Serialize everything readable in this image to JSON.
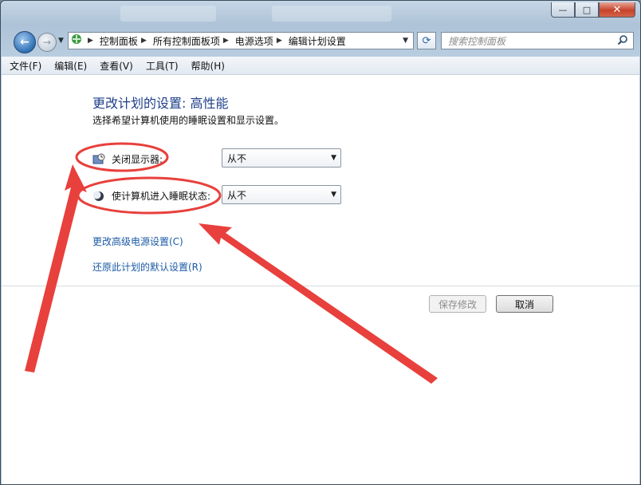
{
  "window": {
    "minimize_glyph": "—",
    "maximize_glyph": "□",
    "close_glyph": "✕"
  },
  "nav": {
    "back_glyph": "←",
    "forward_glyph": "→",
    "breadcrumbs": [
      "控制面板",
      "所有控制面板项",
      "电源选项",
      "编辑计划设置"
    ],
    "refresh_glyph": "⟳"
  },
  "search": {
    "placeholder": "搜索控制面板",
    "value": ""
  },
  "menubar": {
    "items": [
      "文件(F)",
      "编辑(E)",
      "查看(V)",
      "工具(T)",
      "帮助(H)"
    ]
  },
  "main": {
    "heading": "更改计划的设置: 高性能",
    "subtitle": "选择希望计算机使用的睡眠设置和显示设置。",
    "settings": [
      {
        "label": "关闭显示器:",
        "value": "从不",
        "icon": "display-clock-icon"
      },
      {
        "label": "使计算机进入睡眠状态:",
        "value": "从不",
        "icon": "moon-icon"
      }
    ],
    "links": {
      "advanced": "更改高级电源设置(C)",
      "restore": "还原此计划的默认设置(R)"
    },
    "buttons": {
      "save": "保存修改",
      "cancel": "取消"
    }
  },
  "colors": {
    "heading": "#1e3f8a",
    "link": "#1b5aa6",
    "annotation": "#e8403c"
  }
}
